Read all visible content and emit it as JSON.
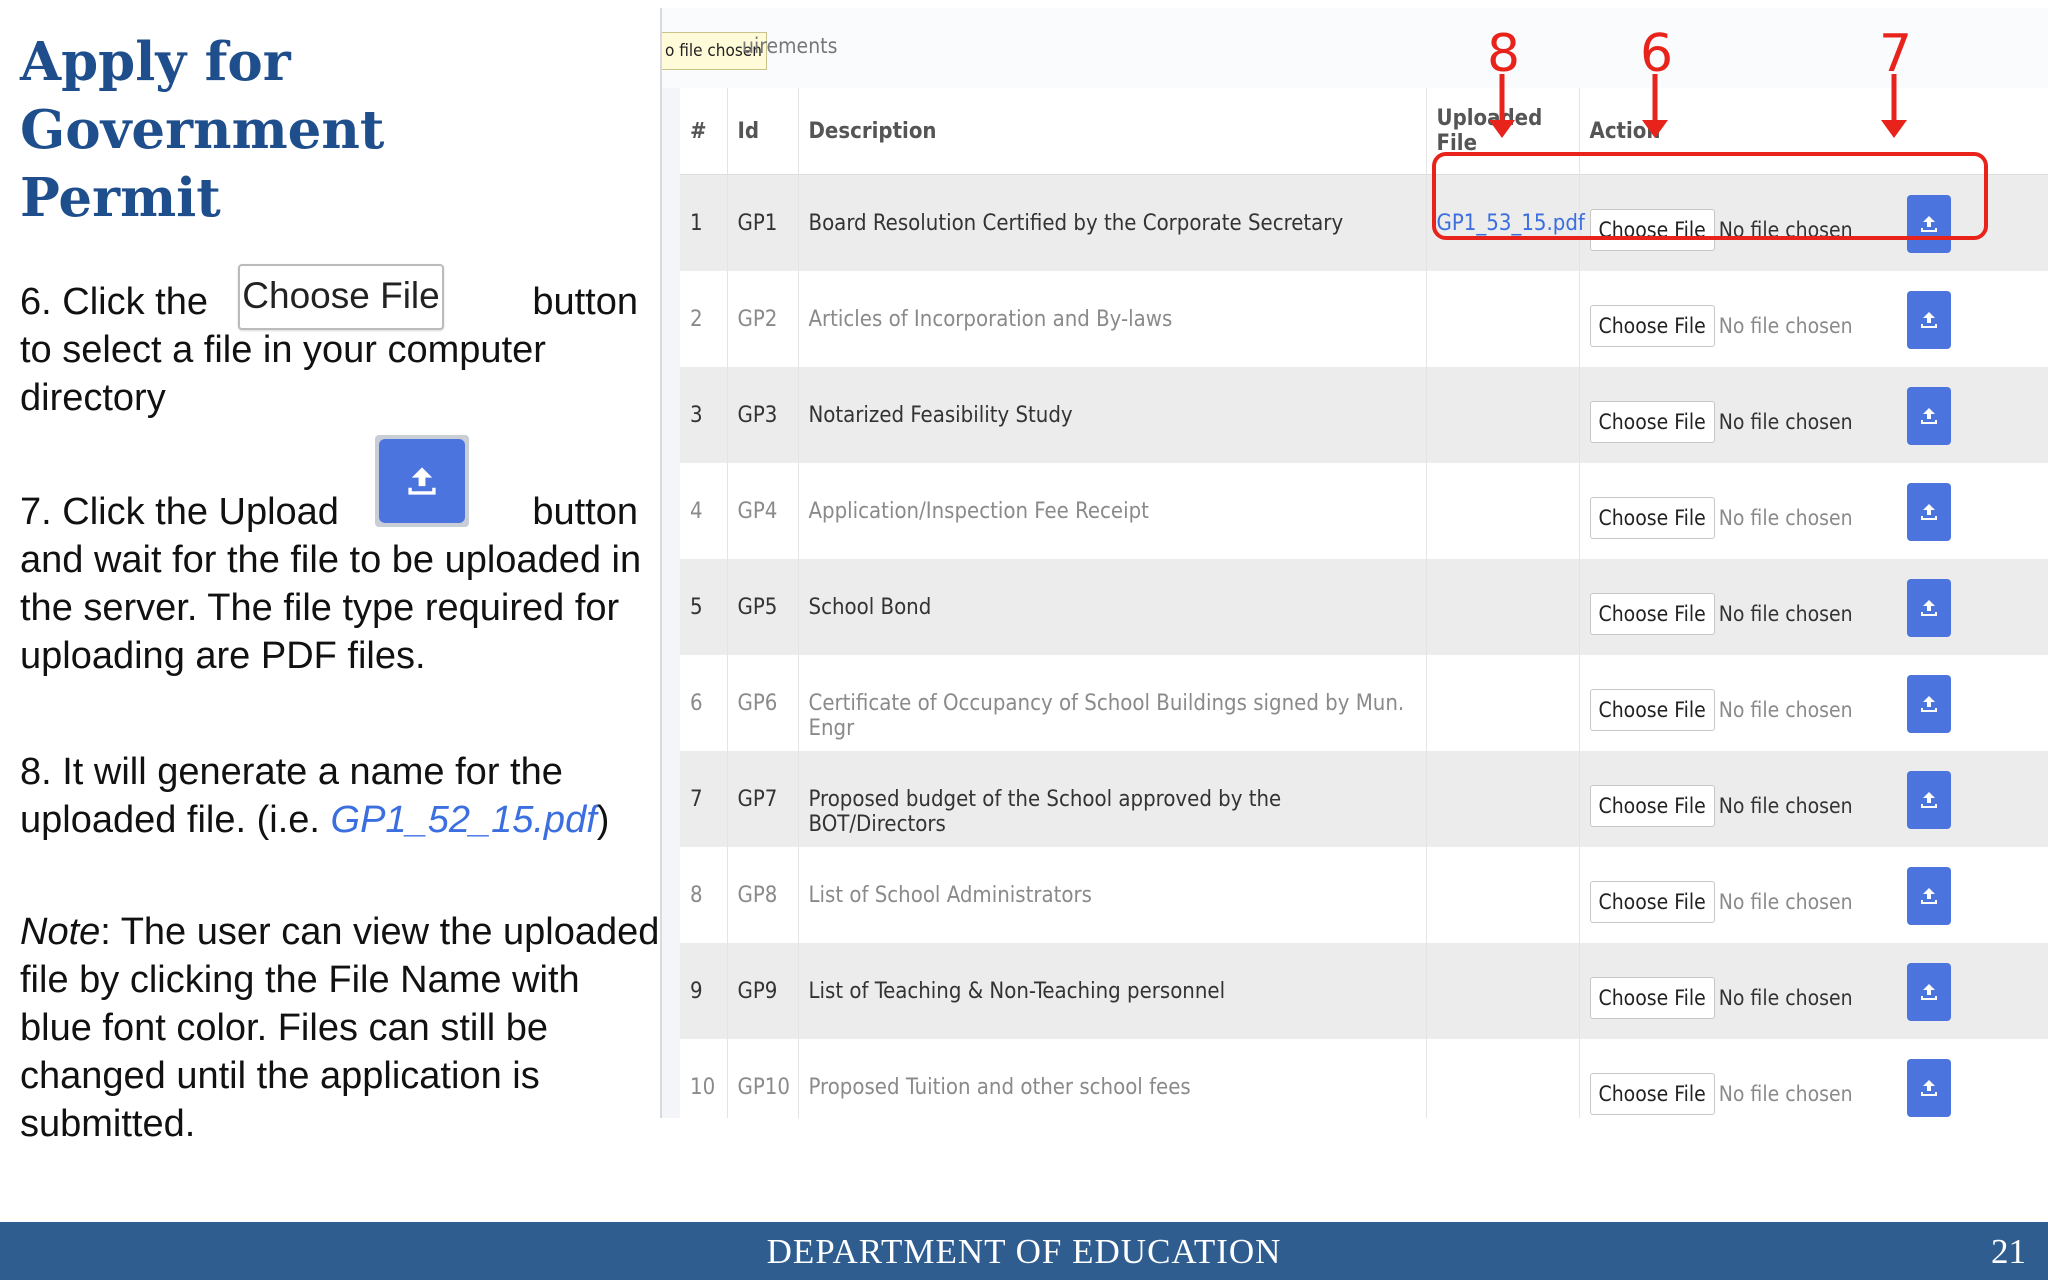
{
  "slide": {
    "title": "Apply for Government Permit",
    "step6": {
      "before": "6. Click the",
      "button_label": "Choose File",
      "after_right": "button",
      "rest": "to select a file in your computer directory"
    },
    "step7": {
      "before": "7. Click the Upload",
      "after_right": "button",
      "rest": "and wait for the file to be uploaded in the server. The file type required for uploading are PDF files."
    },
    "step8": {
      "text": "8. It will generate a name for the uploaded file. (i.e. ",
      "example_file": "GP1_52_15.pdf",
      "close": ")"
    },
    "note": {
      "label": "Note",
      "text": ": The user can view the uploaded file by clicking the File Name with blue font color. Files can still be changed until the application is submitted."
    }
  },
  "screenshot": {
    "tooltip": "o file chosen",
    "header_partial": "uirements",
    "columns": [
      "#",
      "Id",
      "Description",
      "Uploaded File",
      "Action"
    ],
    "choose_label": "Choose File",
    "no_file": "No file chosen",
    "rows": [
      {
        "num": "1",
        "id": "GP1",
        "desc": "Board Resolution Certified by the Corporate Secretary",
        "file": "GP1_53_15.pdf"
      },
      {
        "num": "2",
        "id": "GP2",
        "desc": "Articles of Incorporation and By-laws",
        "file": ""
      },
      {
        "num": "3",
        "id": "GP3",
        "desc": "Notarized Feasibility Study",
        "file": ""
      },
      {
        "num": "4",
        "id": "GP4",
        "desc": "Application/Inspection Fee Receipt",
        "file": ""
      },
      {
        "num": "5",
        "id": "GP5",
        "desc": "School Bond",
        "file": ""
      },
      {
        "num": "6",
        "id": "GP6",
        "desc": "Certificate of Occupancy of School Buildings signed by Mun. Engr",
        "file": ""
      },
      {
        "num": "7",
        "id": "GP7",
        "desc": "Proposed budget of the School approved by the BOT/Directors",
        "file": ""
      },
      {
        "num": "8",
        "id": "GP8",
        "desc": "List of School Administrators",
        "file": ""
      },
      {
        "num": "9",
        "id": "GP9",
        "desc": "List of Teaching & Non-Teaching personnel",
        "file": ""
      },
      {
        "num": "10",
        "id": "GP10",
        "desc": "Proposed Tuition and other school fees",
        "file": ""
      }
    ],
    "annotations": [
      "8",
      "6",
      "7"
    ],
    "annotation_color": "#e8231b"
  },
  "footer": {
    "department": "DEPARTMENT OF EDUCATION",
    "page": "21"
  },
  "colors": {
    "title": "#1f4e8c",
    "upload_button": "#4b74df",
    "link": "#3b6fe0",
    "footer_bg": "#2f5d90"
  }
}
